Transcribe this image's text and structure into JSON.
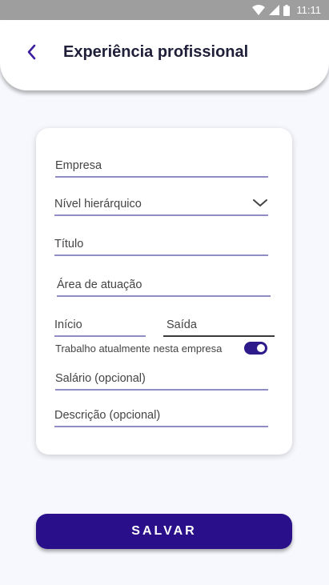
{
  "status_bar": {
    "time": "11:11"
  },
  "header": {
    "title": "Experiência profissional"
  },
  "form": {
    "company": "Empresa",
    "level": "Nível hierárquico",
    "job_title": "Título",
    "area": "Área de atuação",
    "start": "Início",
    "end": "Saída",
    "current_job_label": "Trabalho atualmente nesta empresa",
    "current_job_on": true,
    "salary": "Salário (opcional)",
    "description": "Descrição (opcional)"
  },
  "actions": {
    "save_label": "SALVAR"
  },
  "colors": {
    "accent": "#2a0f8a",
    "underline": "#8f8cc6",
    "background": "#f7f8fd",
    "status_bar": "#9e9e9e"
  }
}
